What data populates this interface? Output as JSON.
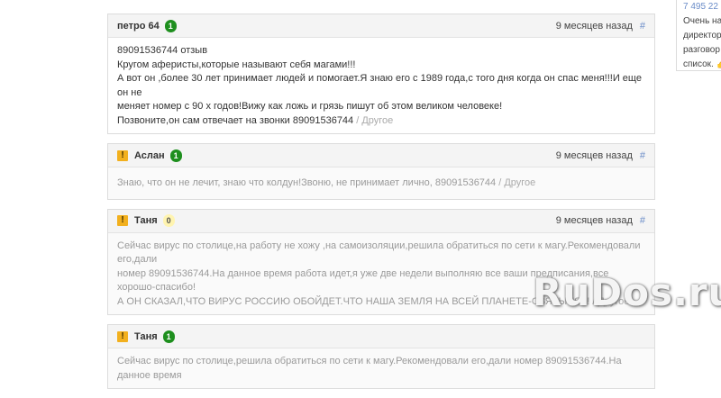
{
  "sidebar_snippet": {
    "top": "7 495 22",
    "lines": [
      "Очень на",
      "директор",
      "разговор",
      "список. 👍"
    ]
  },
  "reviews": [
    {
      "author": "петро 64",
      "warning": false,
      "rating": "1",
      "time": "9 месяцев назад",
      "hash": "#",
      "lines": [
        "89091536744 отзыв",
        "Кругом аферисты,которые называют себя магами!!!",
        "А вот он ,более 30 лет принимает людей и помогает.Я знаю его с 1989 года,с того дня когда он спас меня!!!И еще он не",
        "меняет номер с 90 х годов!Вижу как ложь и грязь пишут об этом великом человеке!",
        "Позвоните,он сам отвечает на звонки 89091536744"
      ],
      "category": "Другое"
    },
    {
      "author": "Аслан",
      "warning": true,
      "rating": "1",
      "time": "9 месяцев назад",
      "hash": "#",
      "lines": [
        "Знаю, что он не лечит, знаю что колдун!Звоню, не принимает лично, 89091536744"
      ],
      "category": "Другое"
    },
    {
      "author": "Таня",
      "warning": true,
      "rating": "0",
      "time": "9 месяцев назад",
      "hash": "#",
      "lines": [
        "Сейчас вирус по столице,на работу не хожу ,на самоизоляции,решила обратиться по сети к магу.Рекомендовали его,дали",
        "номер 89091536744.На данное время работа идет,я уже две недели выполняю все ваши предписания,все хорошо-спасибо!",
        "А ОН СКАЗАЛ,ЧТО ВИРУС РОССИЮ ОБОЙДЕТ.ЧТО НАША ЗЕМЛЯ НА ВСЕЙ ПЛАНЕТЕ-СВЯТЫНЯ!!!"
      ],
      "category": "Другое"
    },
    {
      "author": "Таня",
      "warning": true,
      "rating": "1",
      "time": "9 месяцев назад",
      "hash": "#",
      "lines": [
        "Сейчас вирус по столице,решила обратиться по сети к магу.Рекомендовали его,дали номер 89091536744.На данное время"
      ],
      "category": ""
    }
  ],
  "separator": " / ",
  "warning_symbol": "!",
  "watermark": "RuDos.ru"
}
